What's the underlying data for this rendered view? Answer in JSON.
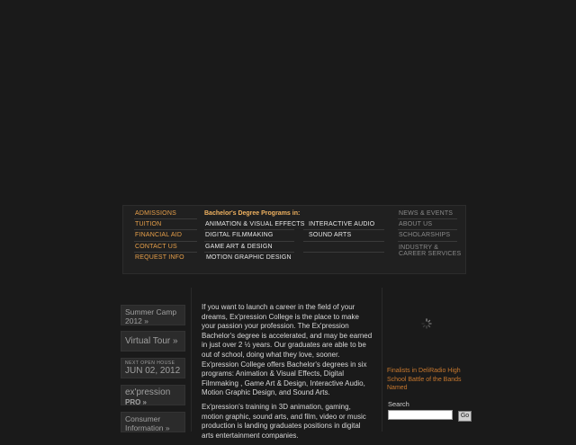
{
  "nav": {
    "left_links": [
      {
        "label": "ADMISSIONS"
      },
      {
        "label": "TUITION"
      },
      {
        "label": "FINANCIAL AID"
      },
      {
        "label": "CONTACT US"
      },
      {
        "label": "REQUEST INFO"
      }
    ],
    "programs_heading": "Bachelor's Degree Programs in:",
    "programs_col1": [
      {
        "label": "ANIMATION & VISUAL EFFECTS"
      },
      {
        "label": "DIGITAL FILMMAKING"
      },
      {
        "label": "GAME ART & DESIGN"
      },
      {
        "label": "MOTION GRAPHIC DESIGN"
      }
    ],
    "programs_col2": [
      {
        "label": "INTERACTIVE AUDIO"
      },
      {
        "label": "SOUND ARTS"
      }
    ],
    "right_links": [
      {
        "label": "NEWS & EVENTS"
      },
      {
        "label": "ABOUT US"
      },
      {
        "label": "SCHOLARSHIPS"
      },
      {
        "label_line1": "INDUSTRY &",
        "label_line2": "CAREER SERVICES"
      }
    ]
  },
  "promos": {
    "summer_camp_line1": "Summer Camp",
    "summer_camp_line2": "2012 »",
    "virtual_tour": "Virtual Tour »",
    "open_house_small": "NEXT OPEN HOUSE",
    "open_house_date": "JUN 02, 2012",
    "pro_line1": "ex'pression",
    "pro_line2": "PRO »",
    "consumer_line1": "Consumer",
    "consumer_line2": "Information »"
  },
  "main": {
    "para1": "If you want to launch a career in the field of your dreams, Ex'pression College is the place to make your passion your profession. The Ex'pression Bachelor's degree is accelerated, and may be earned in just over 2 ½ years. Our graduates are able to be out of school, doing what they love, sooner. Ex'pression College offers Bachelor's degrees in six programs: Animation & Visual Effects, Digital Filmmaking , Game Art & Design, Interactive Audio, Motion Graphic Design, and Sound Arts.",
    "para2": "Ex'pression's training in 3D animation, gaming, motion graphic, sound arts, and film, video or music production is landing graduates positions in digital arts entertainment companies."
  },
  "sidebar": {
    "news_headline": "Finalists in DeliRadio High School Battle of the Bands Named",
    "search_label": "Search",
    "search_value": "",
    "go_label": "Go"
  },
  "colors": {
    "accent": "#e8a04a",
    "background": "#1a1a1a"
  }
}
